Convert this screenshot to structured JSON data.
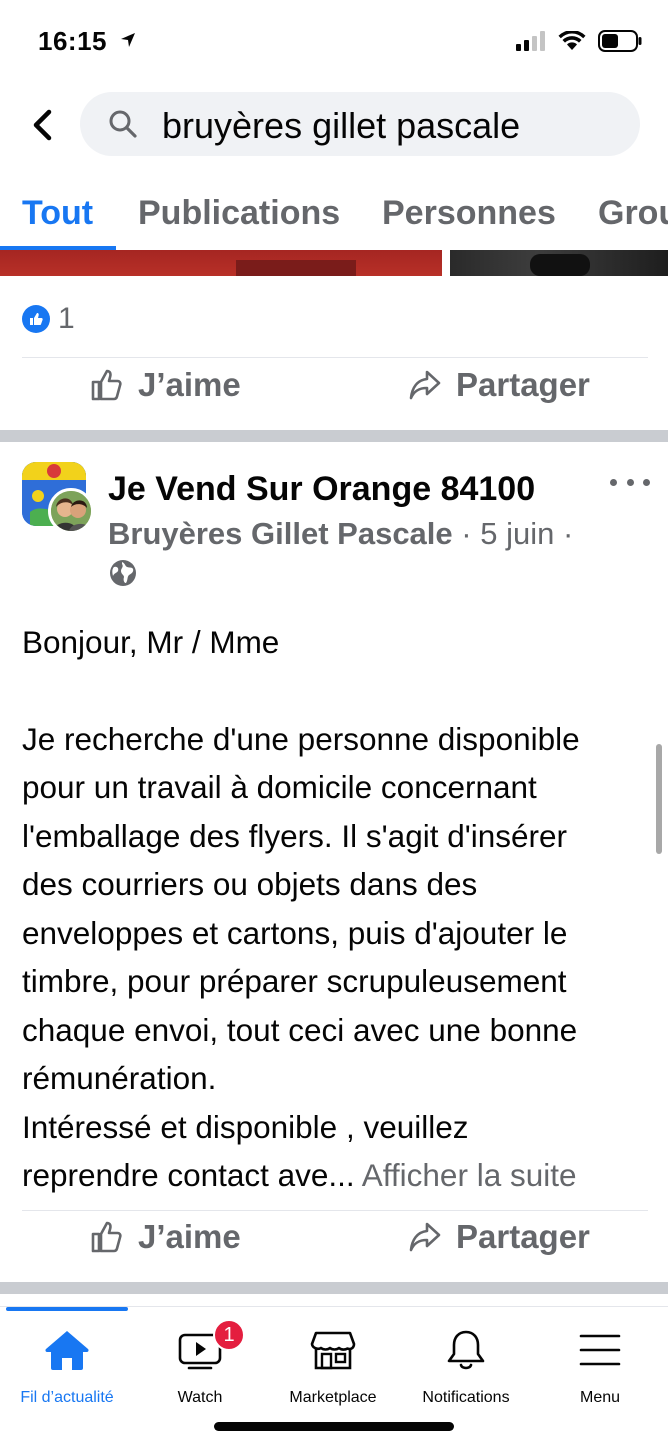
{
  "status_bar": {
    "time": "16:15"
  },
  "search": {
    "query": "bruyères gillet pascale"
  },
  "tabs": [
    {
      "label": "Tout",
      "active": true
    },
    {
      "label": "Publications",
      "active": false
    },
    {
      "label": "Personnes",
      "active": false
    },
    {
      "label": "Grou",
      "active": false
    }
  ],
  "previous_post": {
    "reaction_count": "1",
    "like_label": "J’aime",
    "share_label": "Partager"
  },
  "post": {
    "group_name": "Je Vend Sur Orange 84100",
    "author": "Bruyères Gillet Pascale",
    "date": "5 juin",
    "separator": "·",
    "body_greeting": "Bonjour, Mr / Mme",
    "body_lines": [
      "Je recherche d'une personne disponible",
      "pour un travail à domicile concernant",
      "l'emballage des flyers. Il s'agit d'insérer",
      "des courriers ou objets dans des",
      "enveloppes et cartons, puis d'ajouter le",
      "timbre, pour préparer scrupuleusement",
      "chaque envoi, tout ceci avec une bonne",
      "rémunération.",
      "Intéressé et disponible , veuillez"
    ],
    "body_last_line": "reprendre contact ave...",
    "see_more": "Afficher la suite",
    "like_label": "J’aime",
    "share_label": "Partager"
  },
  "bottom_nav": {
    "items": [
      {
        "label": "Fil d’actualité",
        "icon": "home-icon",
        "active": true
      },
      {
        "label": "Watch",
        "icon": "watch-icon",
        "badge": "1"
      },
      {
        "label": "Marketplace",
        "icon": "marketplace-icon"
      },
      {
        "label": "Notifications",
        "icon": "bell-icon"
      },
      {
        "label": "Menu",
        "icon": "menu-icon"
      }
    ]
  },
  "colors": {
    "accent": "#1877f2",
    "secondary_text": "#65676b",
    "badge": "#e41e3f"
  }
}
